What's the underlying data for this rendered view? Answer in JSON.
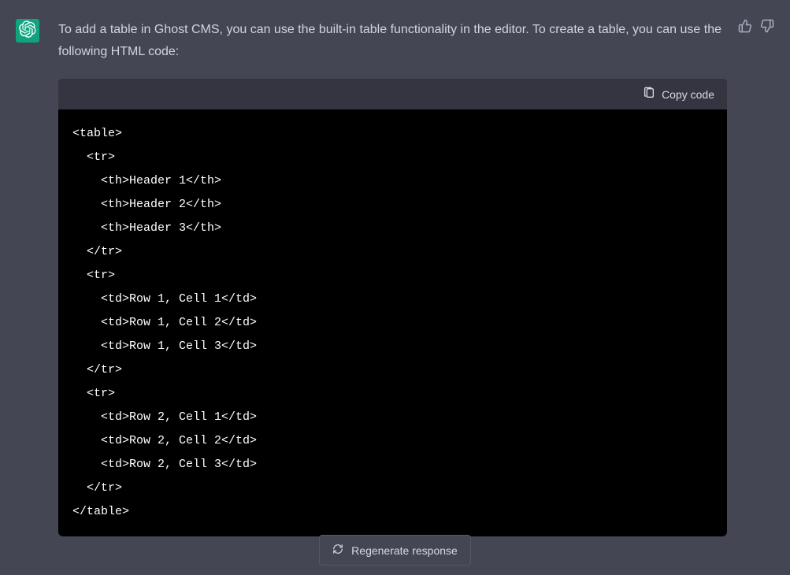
{
  "response": {
    "text": "To add a table in Ghost CMS, you can use the built-in table functionality in the editor. To create a table, you can use the following HTML code:"
  },
  "code": {
    "copy_label": "Copy code",
    "content": "<table>\n  <tr>\n    <th>Header 1</th>\n    <th>Header 2</th>\n    <th>Header 3</th>\n  </tr>\n  <tr>\n    <td>Row 1, Cell 1</td>\n    <td>Row 1, Cell 2</td>\n    <td>Row 1, Cell 3</td>\n  </tr>\n  <tr>\n    <td>Row 2, Cell 1</td>\n    <td>Row 2, Cell 2</td>\n    <td>Row 2, Cell 3</td>\n  </tr>\n</table>"
  },
  "actions": {
    "regenerate": "Regenerate response"
  }
}
